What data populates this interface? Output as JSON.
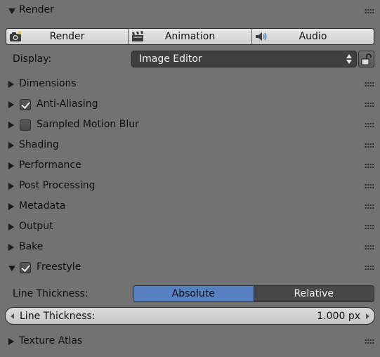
{
  "panel": {
    "title": "Render",
    "buttons": {
      "render": "Render",
      "animation": "Animation",
      "audio": "Audio"
    },
    "display": {
      "label": "Display:",
      "value": "Image Editor"
    },
    "sections": [
      {
        "label": "Dimensions",
        "expanded": false
      },
      {
        "label": "Anti-Aliasing",
        "checkbox": true,
        "checked": true,
        "expanded": false
      },
      {
        "label": "Sampled Motion Blur",
        "checkbox": true,
        "checked": false,
        "expanded": false
      },
      {
        "label": "Shading",
        "expanded": false
      },
      {
        "label": "Performance",
        "expanded": false
      },
      {
        "label": "Post Processing",
        "expanded": false
      },
      {
        "label": "Metadata",
        "expanded": false
      },
      {
        "label": "Output",
        "expanded": false
      },
      {
        "label": "Bake",
        "expanded": false
      },
      {
        "label": "Freestyle",
        "checkbox": true,
        "checked": true,
        "expanded": true
      }
    ],
    "freestyle": {
      "thickness_mode_label": "Line Thickness:",
      "mode_options": [
        "Absolute",
        "Relative"
      ],
      "selected_mode": "Absolute",
      "thickness_field_label": "Line Thickness:",
      "thickness_value": "1.000 px"
    },
    "texture_atlas": {
      "label": "Texture Atlas",
      "expanded": false
    }
  },
  "colors": {
    "background": "#727272",
    "accent": "#5680c2"
  },
  "icons": [
    "expand-triangle-icon",
    "collapse-triangle-icon",
    "drag-grip-icon",
    "camera-icon",
    "clapperboard-icon",
    "speaker-icon",
    "lock-icon",
    "checkmark-icon",
    "select-arrows-icon"
  ]
}
